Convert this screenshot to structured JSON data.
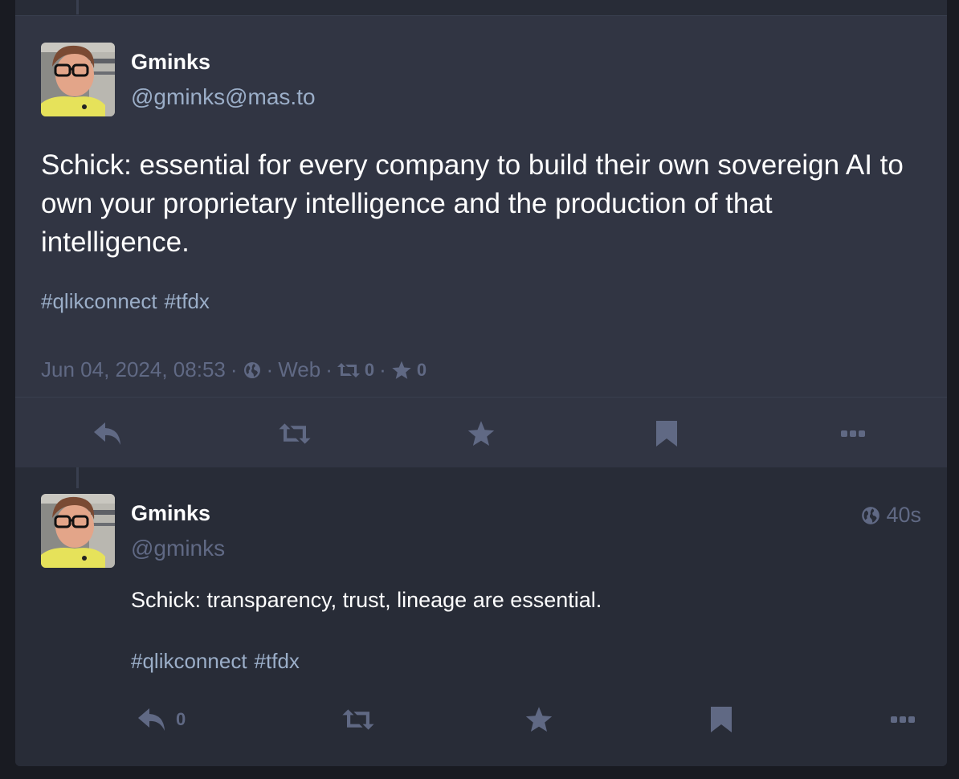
{
  "main_status": {
    "display_name": "Gminks",
    "acct": "@gminks@mas.to",
    "content": "Schick: essential for every company to build their own sovereign AI to own your proprietary intelligence and the production of that intelligence.",
    "hashtags": [
      "#qlikconnect",
      "#tfdx"
    ],
    "date": "Jun 04, 2024, 08:53",
    "visibility_icon": "globe-icon",
    "application": "Web",
    "boost_count": "0",
    "favourite_count": "0",
    "actions": [
      "reply-icon",
      "boost-icon",
      "star-icon",
      "bookmark-icon",
      "more-icon"
    ]
  },
  "reply_status": {
    "display_name": "Gminks",
    "acct": "@gminks",
    "relative_time": "40s",
    "content": "Schick: transparency, trust, lineage are essential.",
    "hashtags": [
      "#qlikconnect",
      "#tfdx"
    ],
    "reply_count": "0",
    "actions": [
      "reply-icon",
      "boost-icon",
      "star-icon",
      "bookmark-icon",
      "more-icon"
    ]
  },
  "colors": {
    "background": "#191b22",
    "main_panel": "#313543",
    "reply_panel": "#282c37",
    "secondary_text": "#9baec8",
    "muted_text": "#606984"
  }
}
